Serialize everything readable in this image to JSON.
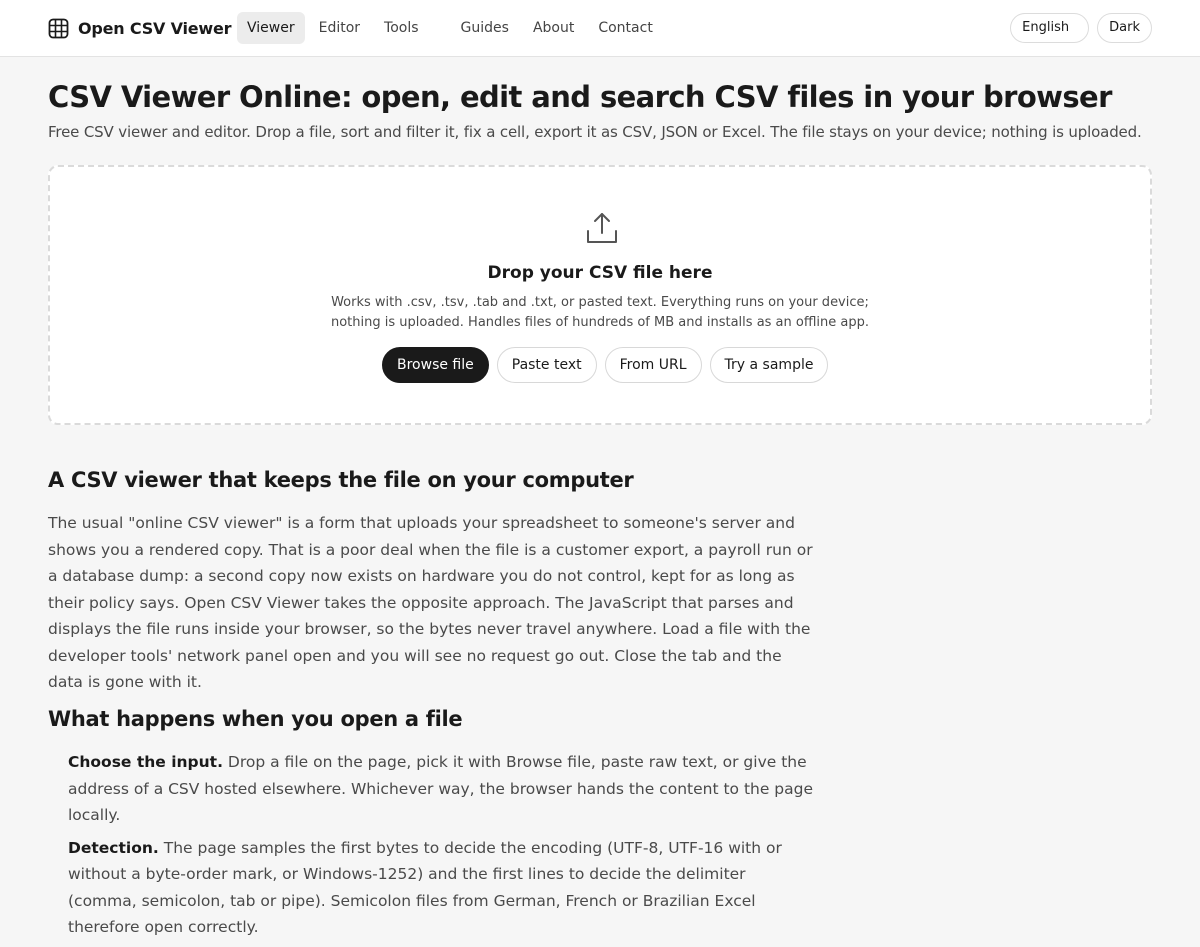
{
  "brand": {
    "name": "Open CSV Viewer",
    "icon": "grid-icon"
  },
  "nav": {
    "items": [
      {
        "label": "Viewer",
        "active": true
      },
      {
        "label": "Editor"
      },
      {
        "label": "Tools"
      },
      {
        "label": "Guides"
      },
      {
        "label": "About"
      },
      {
        "label": "Contact"
      }
    ],
    "language": "English",
    "theme": "Dark"
  },
  "hero": {
    "title": "CSV Viewer Online: open, edit and search CSV files in your browser",
    "subtitle": "Free CSV viewer and editor. Drop a file, sort and filter it, fix a cell, export it as CSV, JSON or Excel. The file stays on your device; nothing is uploaded."
  },
  "dropzone": {
    "icon": "upload-icon",
    "title": "Drop your CSV file here",
    "desc_line1": "Works with .csv, .tsv, .tab and .txt, or pasted text. Everything runs on your device;",
    "desc_line2": "nothing is uploaded. Handles files of hundreds of MB and installs as an offline app.",
    "buttons": {
      "browse": "Browse file",
      "paste": "Paste text",
      "url": "From URL",
      "sample": "Try a sample"
    }
  },
  "section1": {
    "heading": "A CSV viewer that keeps the file on your computer",
    "body": "The usual \"online CSV viewer\" is a form that uploads your spreadsheet to someone's server and shows you a rendered copy. That is a poor deal when the file is a customer export, a payroll run or a database dump: a second copy now exists on hardware you do not control, kept for as long as their policy says. Open CSV Viewer takes the opposite approach. The JavaScript that parses and displays the file runs inside your browser, so the bytes never travel anywhere. Load a file with the developer tools' network panel open and you will see no request go out. Close the tab and the data is gone with it."
  },
  "section2": {
    "heading": "What happens when you open a file",
    "steps": [
      {
        "title": "Choose the input.",
        "text": " Drop a file on the page, pick it with Browse file, paste raw text, or give the address of a CSV hosted elsewhere. Whichever way, the browser hands the content to the page locally."
      },
      {
        "title": "Detection.",
        "text": " The page samples the first bytes to decide the encoding (UTF-8, UTF-16 with or without a byte-order mark, or Windows-1252) and the first lines to decide the delimiter (comma, semicolon, tab or pipe). Semicolon files from German, French or Brazilian Excel therefore open correctly."
      }
    ]
  }
}
